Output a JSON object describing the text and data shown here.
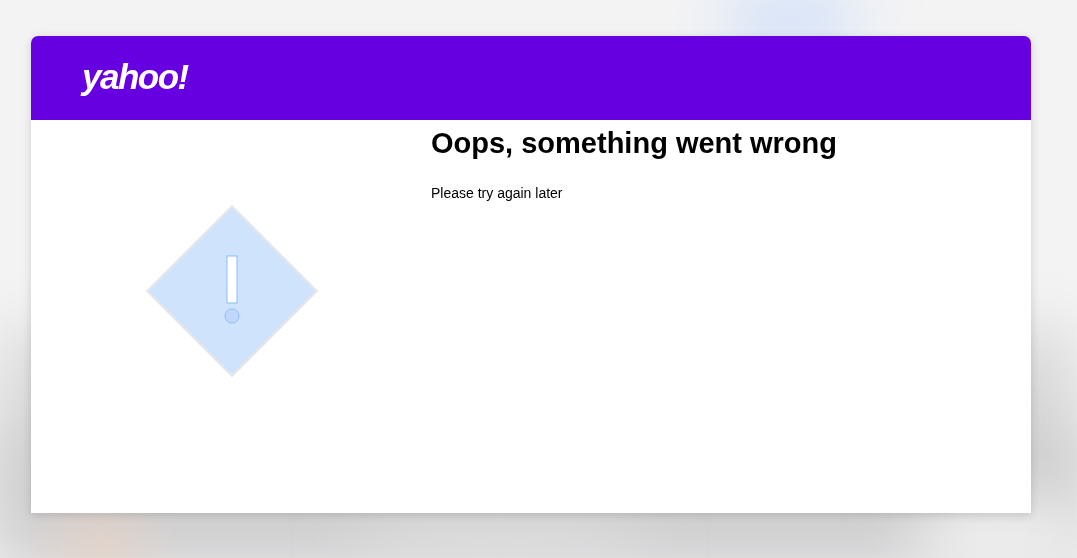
{
  "header": {
    "logo": "yahoo!"
  },
  "error": {
    "title": "Oops, something went wrong",
    "message": "Please try again later"
  }
}
